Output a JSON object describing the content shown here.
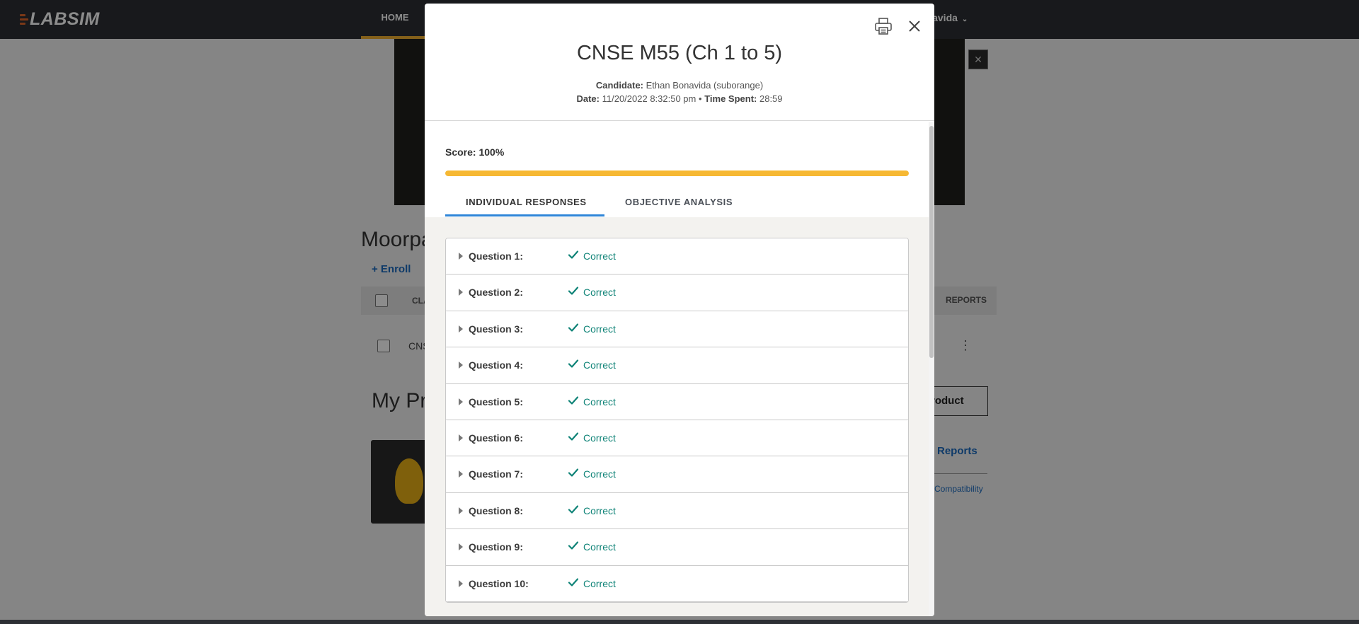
{
  "app": {
    "logo_text": "LABSIM",
    "nav_home": "HOME",
    "user_name": "onavida"
  },
  "background": {
    "section_title": "Moorpa",
    "enroll_label": "+ Enroll",
    "class_col": "CLA",
    "reports_col": "REPORTS",
    "class_row_text": "CNS",
    "my_products_title": "My Pr",
    "product_button": "roduct",
    "reports_link": "Reports",
    "compat_link": "Compatibility"
  },
  "modal": {
    "title": "CNSE M55 (Ch 1 to 5)",
    "candidate_label": "Candidate:",
    "candidate_value": "Ethan Bonavida  (suborange)",
    "date_label": "Date:",
    "date_value": "11/20/2022 8:32:50 pm",
    "separator": "•",
    "time_spent_label": "Time Spent:",
    "time_spent_value": "28:59",
    "score_text": "Score: 100%",
    "score_fraction": 1.0,
    "tabs": [
      {
        "label": "INDIVIDUAL RESPONSES",
        "active": true
      },
      {
        "label": "OBJECTIVE ANALYSIS",
        "active": false
      }
    ],
    "questions": [
      {
        "label": "Question 1:",
        "status": "Correct"
      },
      {
        "label": "Question 2:",
        "status": "Correct"
      },
      {
        "label": "Question 3:",
        "status": "Correct"
      },
      {
        "label": "Question 4:",
        "status": "Correct"
      },
      {
        "label": "Question 5:",
        "status": "Correct"
      },
      {
        "label": "Question 6:",
        "status": "Correct"
      },
      {
        "label": "Question 7:",
        "status": "Correct"
      },
      {
        "label": "Question 8:",
        "status": "Correct"
      },
      {
        "label": "Question 9:",
        "status": "Correct"
      },
      {
        "label": "Question 10:",
        "status": "Correct"
      }
    ]
  },
  "colors": {
    "nav_bg": "#2d2f34",
    "accent_orange": "#f6b833",
    "tab_underline": "#2f86d8",
    "correct_teal": "#0f8377"
  },
  "icons": {
    "print": "printer-icon",
    "close": "close-icon",
    "expand": "caret-right-icon",
    "correct": "checkmark-icon"
  }
}
